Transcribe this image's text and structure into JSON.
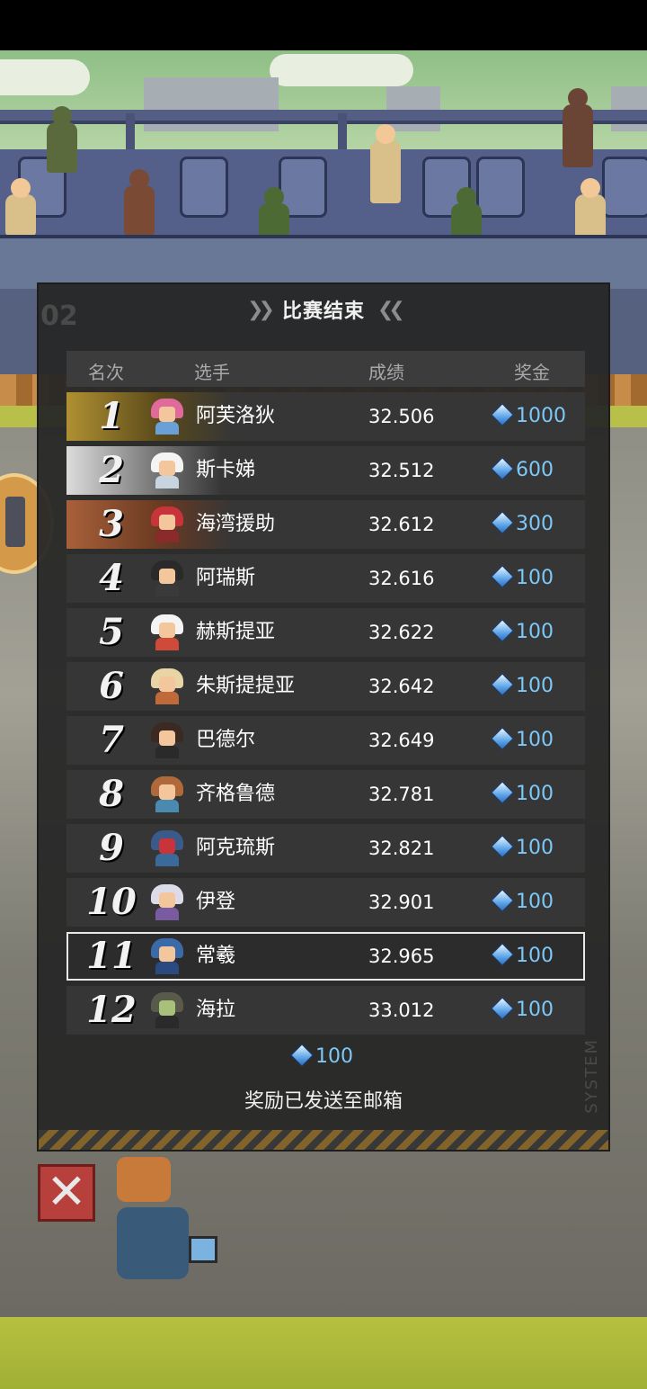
{
  "panel": {
    "title": "比赛结束",
    "headers": {
      "rank": "名次",
      "player": "选手",
      "score": "成绩",
      "prize": "奖金"
    },
    "rows": [
      {
        "rank": "1",
        "name": "阿芙洛狄",
        "score": "32.506",
        "prize": "1000"
      },
      {
        "rank": "2",
        "name": "斯卡娣",
        "score": "32.512",
        "prize": "600"
      },
      {
        "rank": "3",
        "name": "海湾援助",
        "score": "32.612",
        "prize": "300"
      },
      {
        "rank": "4",
        "name": "阿瑞斯",
        "score": "32.616",
        "prize": "100"
      },
      {
        "rank": "5",
        "name": "赫斯提亚",
        "score": "32.622",
        "prize": "100"
      },
      {
        "rank": "6",
        "name": "朱斯提提亚",
        "score": "32.642",
        "prize": "100"
      },
      {
        "rank": "7",
        "name": "巴德尔",
        "score": "32.649",
        "prize": "100"
      },
      {
        "rank": "8",
        "name": "齐格鲁德",
        "score": "32.781",
        "prize": "100"
      },
      {
        "rank": "9",
        "name": "阿克琉斯",
        "score": "32.821",
        "prize": "100"
      },
      {
        "rank": "10",
        "name": "伊登",
        "score": "32.901",
        "prize": "100"
      },
      {
        "rank": "11",
        "name": "常羲",
        "score": "32.965",
        "prize": "100"
      },
      {
        "rank": "12",
        "name": "海拉",
        "score": "33.012",
        "prize": "100"
      }
    ],
    "reward_total": "100",
    "reward_notice": "奖励已发送至邮箱"
  },
  "icons": {
    "currency": "diamond-gem-icon",
    "close": "close-x-icon"
  },
  "colors": {
    "gold": "#b09032",
    "silver": "#dcdcdc",
    "bronze": "#a8603a",
    "prize_text": "#7ec8f8",
    "close_button": "#b8403c"
  }
}
